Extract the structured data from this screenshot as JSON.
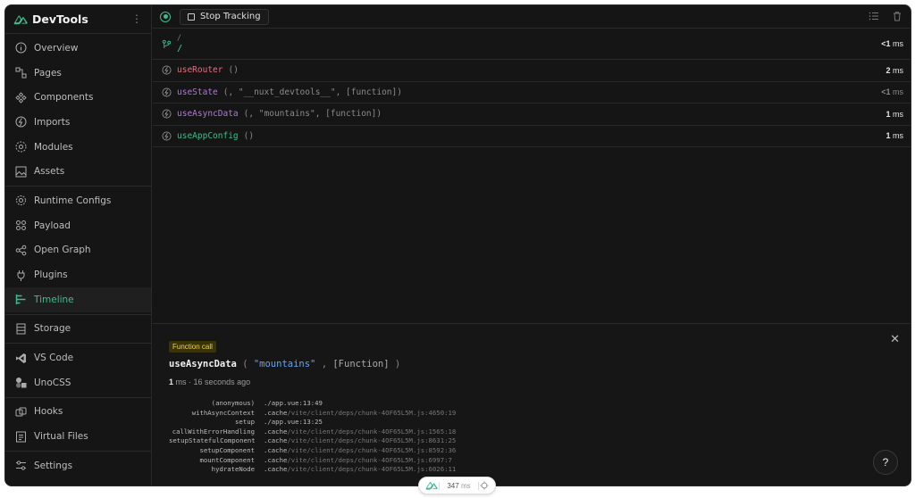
{
  "app": {
    "title": "DevTools"
  },
  "sidebar": {
    "groups": [
      [
        {
          "label": "Overview",
          "icon": "info-icon"
        },
        {
          "label": "Pages",
          "icon": "pages-icon"
        },
        {
          "label": "Components",
          "icon": "components-icon"
        },
        {
          "label": "Imports",
          "icon": "imports-icon"
        },
        {
          "label": "Modules",
          "icon": "modules-icon"
        },
        {
          "label": "Assets",
          "icon": "assets-icon"
        }
      ],
      [
        {
          "label": "Runtime Configs",
          "icon": "gear-icon"
        },
        {
          "label": "Payload",
          "icon": "payload-icon"
        },
        {
          "label": "Open Graph",
          "icon": "share-icon"
        },
        {
          "label": "Plugins",
          "icon": "plug-icon"
        },
        {
          "label": "Timeline",
          "icon": "timeline-icon",
          "active": true
        }
      ],
      [
        {
          "label": "Storage",
          "icon": "storage-icon"
        }
      ],
      [
        {
          "label": "VS Code",
          "icon": "vscode-icon"
        },
        {
          "label": "UnoCSS",
          "icon": "unocss-icon"
        }
      ],
      [
        {
          "label": "Hooks",
          "icon": "hooks-icon"
        },
        {
          "label": "Virtual Files",
          "icon": "file-icon"
        }
      ],
      [
        {
          "label": "Settings",
          "icon": "settings-icon"
        }
      ]
    ]
  },
  "toolbar": {
    "stop_label": "Stop Tracking"
  },
  "timeline": {
    "route": {
      "from": "/",
      "to": "/",
      "time": "<1",
      "unit": "ms"
    },
    "rows": [
      {
        "fn": "useRouter",
        "color": "#e4707f",
        "args_text": "()",
        "time": "2",
        "unit": "ms",
        "dim": false
      },
      {
        "fn": "useState",
        "color": "#b178d6",
        "args_text": "(, \"__nuxt_devtools__\", [function])",
        "time": "<1",
        "unit": "ms",
        "dim": true
      },
      {
        "fn": "useAsyncData",
        "color": "#b178d6",
        "args_text": "(, \"mountains\", [function])",
        "time": "1",
        "unit": "ms",
        "dim": false
      },
      {
        "fn": "useAppConfig",
        "color": "#3ebd8c",
        "args_text": "()",
        "time": "1",
        "unit": "ms",
        "dim": false
      }
    ]
  },
  "details": {
    "badge": "Function call",
    "fn": "useAsyncData",
    "arg": "\"mountains\"",
    "arg2": "[Function]",
    "duration": "1",
    "duration_unit": "ms",
    "ago": "16 seconds ago",
    "stack": [
      {
        "fn": "(anonymous)",
        "path_main": "./app.vue:13:49",
        "path_dim": ""
      },
      {
        "fn": "withAsyncContext",
        "path_main": ".cache",
        "path_dim": "/vite/client/deps/chunk-4OF65L5M.js:4650:19"
      },
      {
        "fn": "setup",
        "path_main": "./app.vue:13:25",
        "path_dim": ""
      },
      {
        "fn": "callWithErrorHandling",
        "path_main": ".cache",
        "path_dim": "/vite/client/deps/chunk-4OF65L5M.js:1565:18"
      },
      {
        "fn": "setupStatefulComponent",
        "path_main": ".cache",
        "path_dim": "/vite/client/deps/chunk-4OF65L5M.js:8631:25"
      },
      {
        "fn": "setupComponent",
        "path_main": ".cache",
        "path_dim": "/vite/client/deps/chunk-4OF65L5M.js:8592:36"
      },
      {
        "fn": "mountComponent",
        "path_main": ".cache",
        "path_dim": "/vite/client/deps/chunk-4OF65L5M.js:6997:7"
      },
      {
        "fn": "hydrateNode",
        "path_main": ".cache",
        "path_dim": "/vite/client/deps/chunk-4OF65L5M.js:6026:11"
      }
    ],
    "help": "?"
  },
  "pill": {
    "value": "347",
    "unit": "ms"
  },
  "colors": {
    "accent": "#3ebd8c",
    "badge_bg": "#3b3308",
    "badge_fg": "#f0d24a"
  }
}
